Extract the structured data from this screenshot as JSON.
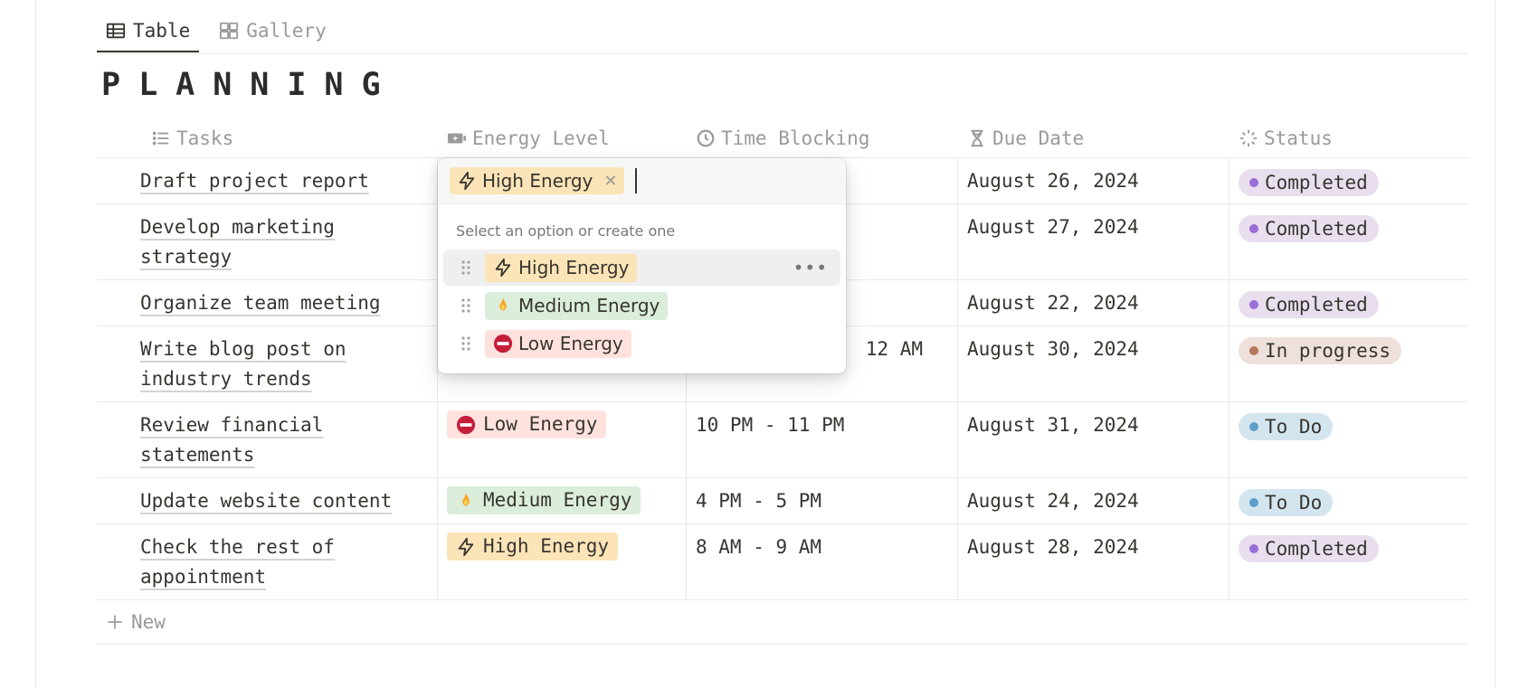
{
  "tabs": [
    {
      "label": "Table",
      "icon": "table-icon",
      "active": true
    },
    {
      "label": "Gallery",
      "icon": "gallery-icon",
      "active": false
    }
  ],
  "page_title": "PLANNING",
  "columns": [
    {
      "label": "Tasks",
      "icon": "list-icon"
    },
    {
      "label": "Energy Level",
      "icon": "battery-icon"
    },
    {
      "label": "Time Blocking",
      "icon": "clock-icon"
    },
    {
      "label": "Due Date",
      "icon": "hourglass-icon"
    },
    {
      "label": "Status",
      "icon": "loading-icon"
    }
  ],
  "rows": [
    {
      "task": "Draft project report",
      "energy": "",
      "time": "",
      "due": "August 26, 2024",
      "status": "Completed"
    },
    {
      "task_lines": [
        "Develop marketing",
        "strategy"
      ],
      "energy": "",
      "time": "",
      "due": "August 27, 2024",
      "status": "Completed"
    },
    {
      "task": "Organize team meeting",
      "energy": "",
      "time": "",
      "due": "August 22, 2024",
      "status": "Completed"
    },
    {
      "task_lines": [
        "Write blog post on",
        "industry trends"
      ],
      "energy": "",
      "time": "12 AM",
      "due": "August 30, 2024",
      "status": "In progress"
    },
    {
      "task_lines": [
        "Review financial",
        "statements"
      ],
      "energy": "Low Energy",
      "time": "10 PM - 11 PM",
      "due": "August 31, 2024",
      "status": "To Do"
    },
    {
      "task": "Update website content",
      "energy": "Medium Energy",
      "time": "4 PM - 5 PM",
      "due": "August 24, 2024",
      "status": "To Do"
    },
    {
      "task_lines": [
        "Check the rest of",
        "appointment"
      ],
      "energy": "High Energy",
      "time": "8 AM - 9 AM",
      "due": "August 28, 2024",
      "status": "Completed"
    }
  ],
  "new_label": "New",
  "dropdown": {
    "selected": "High Energy",
    "hint": "Select an option or create one",
    "options": [
      "High Energy",
      "Medium Energy",
      "Low Energy"
    ]
  },
  "colors": {
    "high": "#fbe4b7",
    "medium": "#dbeddb",
    "low": "#ffe2dd",
    "completed_bg": "#e8deee",
    "completed_dot": "#9a6dd7",
    "inprogress_bg": "#eee0da",
    "inprogress_dot": "#b5785a",
    "todo_bg": "#d3e5ef",
    "todo_dot": "#5e9fca"
  }
}
